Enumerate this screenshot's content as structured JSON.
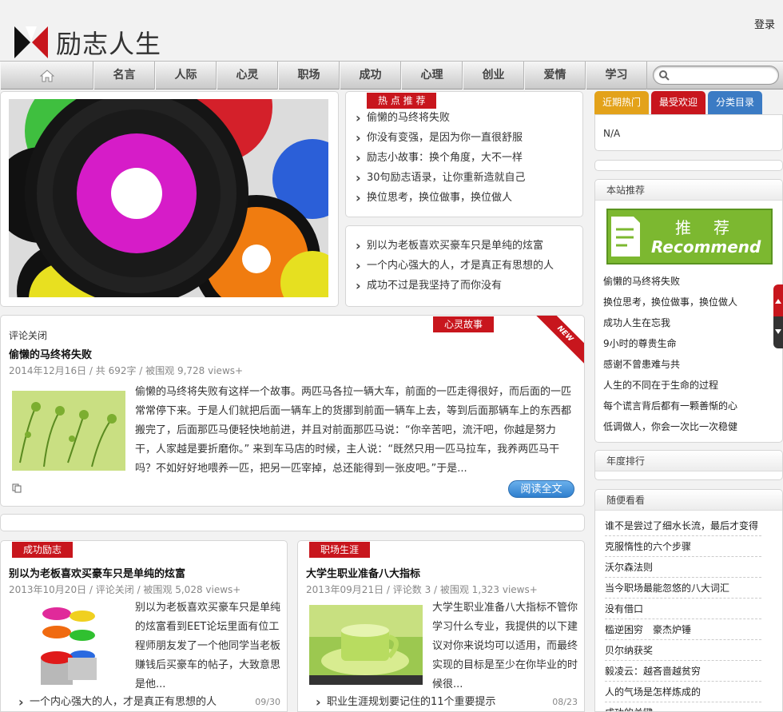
{
  "header": {
    "login": "登录",
    "logo_text": "励志人生"
  },
  "nav": {
    "home_icon": "home-icon",
    "categories": [
      "名言",
      "人际",
      "心灵",
      "职场",
      "成功",
      "心理",
      "创业",
      "爱情",
      "学习"
    ],
    "search_placeholder": ""
  },
  "hot": {
    "tag": "热 点 推 荐",
    "items": [
      "偷懒的马终将失败",
      "你没有变强，是因为你一直很舒服",
      "励志小故事：换个角度，大不一样",
      "30句励志语录，让你重新造就自己",
      "换位思考，换位做事，换位做人"
    ]
  },
  "hot2": {
    "items": [
      "别以为老板喜欢买豪车只是单纯的炫富",
      "一个内心强大的人，才是真正有思想的人",
      "成功不过是我坚持了而你没有"
    ]
  },
  "feature": {
    "tag": "心灵故事",
    "ribbon": "NEW",
    "comment": "评论关闭",
    "title": "偷懒的马终将失败",
    "meta": "2014年12月16日 / 共 692字 / 被围观 9,728 views+",
    "excerpt": "偷懒的马终将失败有这样一个故事。两匹马各拉一辆大车，前面的一匹走得很好，而后面的一匹常常停下来。于是人们就把后面一辆车上的货挪到前面一辆车上去，等到后面那辆车上的东西都搬完了，后面那匹马便轻快地前进，并且对前面那匹马说：“你辛苦吧，流汗吧，你越是努力干，人家越是要折磨你。” 来到车马店的时候，主人说：“既然只用一匹马拉车，我养两匹马干吗？不如好好地喂养一匹，把另一匹宰掉，总还能得到一张皮吧。”于是...",
    "readmore": "阅读全文"
  },
  "col1": {
    "tag": "成功励志",
    "title": "别以为老板喜欢买豪车只是单纯的炫富",
    "meta": "2013年10月20日 / 评论关闭 / 被围观 5,028 views+",
    "excerpt": "别以为老板喜欢买豪车只是单纯的炫富看到EET论坛里面有位工程师朋友发了一个他同学当老板赚钱后买豪车的帖子，大致意思是他...",
    "link": "一个内心强大的人，才是真正有思想的人",
    "date": "09/30"
  },
  "col2": {
    "tag": "职场生涯",
    "title": "大学生职业准备八大指标",
    "meta": "2013年09月21日 / 评论数 3 / 被围观 1,323 views+",
    "excerpt": "大学生职业准备八大指标不管你学习什么专业，我提供的以下建议对你来说均可以适用，而最终实现的目标是至少在你毕业的时候很...",
    "link": "职业生涯规划要记住的11个重要提示",
    "date": "08/23"
  },
  "sidebar": {
    "tabs": [
      {
        "label": "近期热门",
        "color": "#e3a21a"
      },
      {
        "label": "最受欢迎",
        "color": "#c8161d"
      },
      {
        "label": "分类目录",
        "color": "#3b7bc4"
      }
    ],
    "tab_content": "N/A",
    "recommend_head": "本站推荐",
    "banner_cn": "推　荐",
    "banner_en": "Recommend",
    "recommend_items": [
      "偷懒的马终将失败",
      "换位思考，换位做事，换位做人",
      "成功人生在忘我",
      "9小时的尊贵生命",
      "感谢不曾患难与共",
      "人生的不同在于生命的过程",
      "每个谎言背后都有一颗善惭的心",
      "低调做人，你会一次比一次稳健"
    ],
    "year_head": "年度排行",
    "random_head": "随便看看",
    "random_items": [
      "谁不是尝过了细水长流，最后才变得",
      "克服惰性的六个步骤",
      "沃尔森法则",
      "当今职场最能忽悠的八大词汇",
      "没有借口",
      "槛逆困穷　豪杰炉锤",
      "贝尔纳获奖",
      "毅凌云：越吝啬越贫穷",
      "人的气场是怎样炼成的",
      "成功的关键"
    ]
  }
}
